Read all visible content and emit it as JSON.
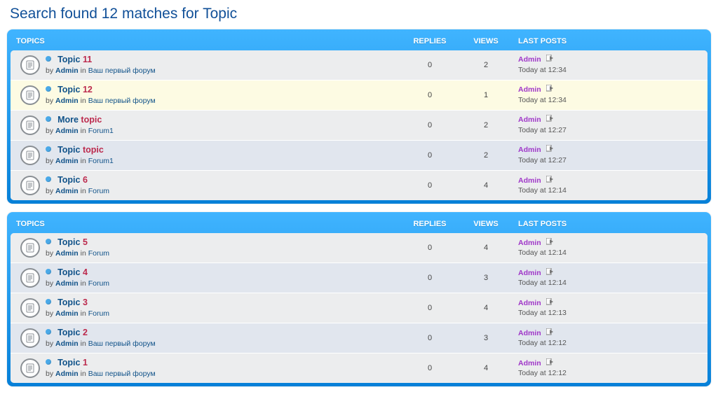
{
  "page_title": "Search found 12 matches for Topic",
  "keyword_display": "topic",
  "headers": {
    "topics": "TOPICS",
    "replies": "REPLIES",
    "views": "VIEWS",
    "lastposts": "LAST POSTS"
  },
  "by_label": "by",
  "in_label": "in",
  "panels": [
    {
      "rows": [
        {
          "title_pre": "Topic",
          "title_kw": " 11",
          "title_post": "",
          "author": "Admin",
          "forum": "Ваш первый форум",
          "replies": "0",
          "views": "2",
          "last_poster": "Admin",
          "time": "Today at 12:34",
          "alt": false,
          "hl": false
        },
        {
          "title_pre": "Topic",
          "title_kw": " 12",
          "title_post": "",
          "author": "Admin",
          "forum": "Ваш первый форум",
          "replies": "0",
          "views": "1",
          "last_poster": "Admin",
          "time": "Today at 12:34",
          "alt": false,
          "hl": true
        },
        {
          "title_pre": "More ",
          "title_kw": "topic",
          "title_post": "",
          "author": "Admin",
          "forum": "Forum1",
          "replies": "0",
          "views": "2",
          "last_poster": "Admin",
          "time": "Today at 12:27",
          "alt": false,
          "hl": false
        },
        {
          "title_pre": "Topic",
          "title_kw": " topic",
          "title_post": "",
          "author": "Admin",
          "forum": "Forum1",
          "replies": "0",
          "views": "2",
          "last_poster": "Admin",
          "time": "Today at 12:27",
          "alt": true,
          "hl": false
        },
        {
          "title_pre": "Topic",
          "title_kw": " 6",
          "title_post": "",
          "author": "Admin",
          "forum": "Forum",
          "replies": "0",
          "views": "4",
          "last_poster": "Admin",
          "time": "Today at 12:14",
          "alt": false,
          "hl": false
        }
      ]
    },
    {
      "rows": [
        {
          "title_pre": "Topic",
          "title_kw": " 5",
          "title_post": "",
          "author": "Admin",
          "forum": "Forum",
          "replies": "0",
          "views": "4",
          "last_poster": "Admin",
          "time": "Today at 12:14",
          "alt": false,
          "hl": false
        },
        {
          "title_pre": "Topic",
          "title_kw": " 4",
          "title_post": "",
          "author": "Admin",
          "forum": "Forum",
          "replies": "0",
          "views": "3",
          "last_poster": "Admin",
          "time": "Today at 12:14",
          "alt": true,
          "hl": false
        },
        {
          "title_pre": "Topic",
          "title_kw": " 3",
          "title_post": "",
          "author": "Admin",
          "forum": "Forum",
          "replies": "0",
          "views": "4",
          "last_poster": "Admin",
          "time": "Today at 12:13",
          "alt": false,
          "hl": false
        },
        {
          "title_pre": "Topic",
          "title_kw": " 2",
          "title_post": "",
          "author": "Admin",
          "forum": "Ваш первый форум",
          "replies": "0",
          "views": "3",
          "last_poster": "Admin",
          "time": "Today at 12:12",
          "alt": true,
          "hl": false
        },
        {
          "title_pre": "Topic",
          "title_kw": " 1",
          "title_post": "",
          "author": "Admin",
          "forum": "Ваш первый форум",
          "replies": "0",
          "views": "4",
          "last_poster": "Admin",
          "time": "Today at 12:12",
          "alt": false,
          "hl": false
        }
      ]
    }
  ]
}
